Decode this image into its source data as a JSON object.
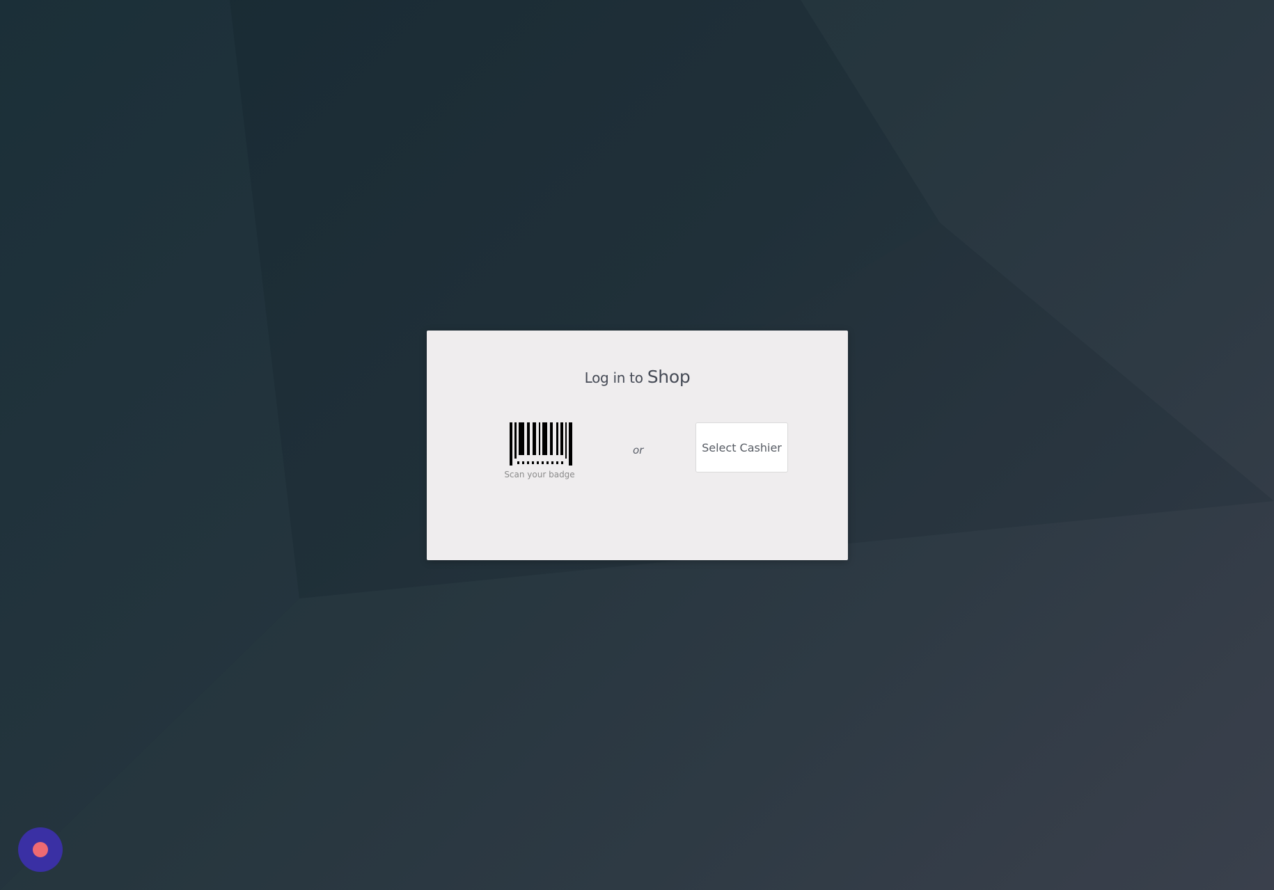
{
  "login": {
    "title_prefix": "Log in to",
    "title_shop": "Shop",
    "scan_label": "Scan your badge",
    "or_label": "or",
    "select_cashier_label": "Select Cashier"
  },
  "debug_button": {
    "icon": "record-dot-icon"
  },
  "colors": {
    "card_background": "#efedee",
    "debug_button": "#3a30a4",
    "debug_dot": "#ee6a72"
  }
}
